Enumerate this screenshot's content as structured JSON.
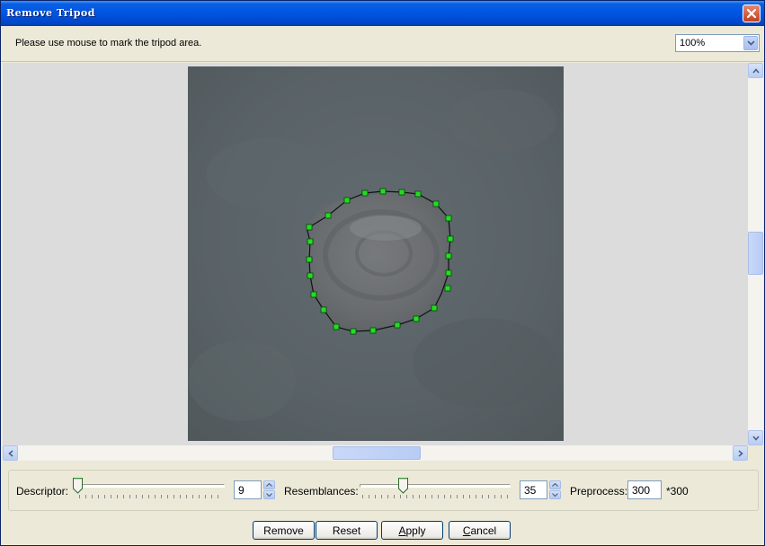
{
  "window": {
    "title": "Remove Tripod"
  },
  "info": {
    "text": "Please use mouse to mark the tripod area."
  },
  "zoom": {
    "value": "100%"
  },
  "controls": {
    "descriptor": {
      "label": "Descriptor:",
      "value": "9"
    },
    "resemblances": {
      "label": "Resemblances:",
      "value": "35"
    },
    "preprocess": {
      "label": "Preprocess:",
      "value": "300",
      "suffix": "*300"
    }
  },
  "buttons": {
    "remove": "Remove",
    "reset": "Reset",
    "apply": "Apply",
    "cancel": "Cancel"
  },
  "colors": {
    "title_bar": "#0054e3",
    "marker": "#22dd22",
    "photo_bg": "#5b6468"
  }
}
